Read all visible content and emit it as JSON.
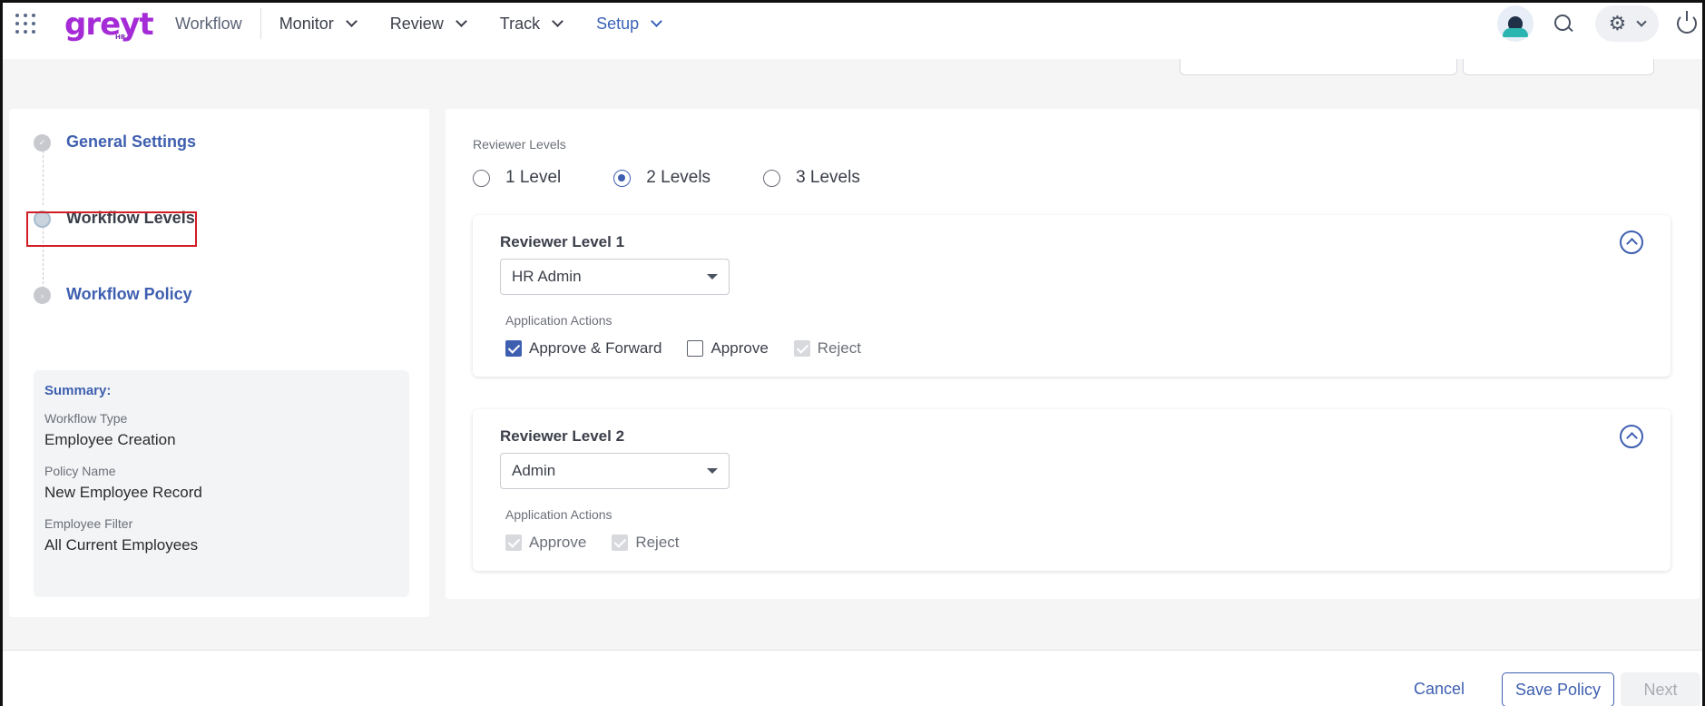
{
  "header": {
    "logo_text": "greyt",
    "logo_sub": "HR",
    "nav": [
      {
        "label": "Workflow"
      },
      {
        "label": "Monitor"
      },
      {
        "label": "Review"
      },
      {
        "label": "Track"
      },
      {
        "label": "Setup"
      }
    ],
    "active_nav": "Setup"
  },
  "steps": [
    {
      "label": "General Settings",
      "state": "done"
    },
    {
      "label": "Workflow Levels",
      "state": "current"
    },
    {
      "label": "Workflow Policy",
      "state": "pending"
    }
  ],
  "summary": {
    "title": "Summary:",
    "items": [
      {
        "label": "Workflow Type",
        "value": "Employee Creation"
      },
      {
        "label": "Policy Name",
        "value": "New Employee Record"
      },
      {
        "label": "Employee Filter",
        "value": "All Current Employees"
      }
    ]
  },
  "reviewer_levels": {
    "label": "Reviewer Levels",
    "options": [
      "1 Level",
      "2 Levels",
      "3 Levels"
    ],
    "selected": "2 Levels"
  },
  "levels": [
    {
      "title": "Reviewer Level 1",
      "role": "HR Admin",
      "actions_label": "Application Actions",
      "actions": [
        {
          "label": "Approve & Forward",
          "state": "checked"
        },
        {
          "label": "Approve",
          "state": "unchecked"
        },
        {
          "label": "Reject",
          "state": "disabled-checked"
        }
      ]
    },
    {
      "title": "Reviewer Level 2",
      "role": "Admin",
      "actions_label": "Application Actions",
      "actions": [
        {
          "label": "Approve",
          "state": "disabled-checked"
        },
        {
          "label": "Reject",
          "state": "disabled-checked"
        }
      ]
    }
  ],
  "footer": {
    "cancel": "Cancel",
    "save": "Save Policy",
    "next": "Next"
  },
  "colors": {
    "accent": "#3e5fb0",
    "brand": "#a42bd6",
    "highlight": "#d11d26"
  }
}
